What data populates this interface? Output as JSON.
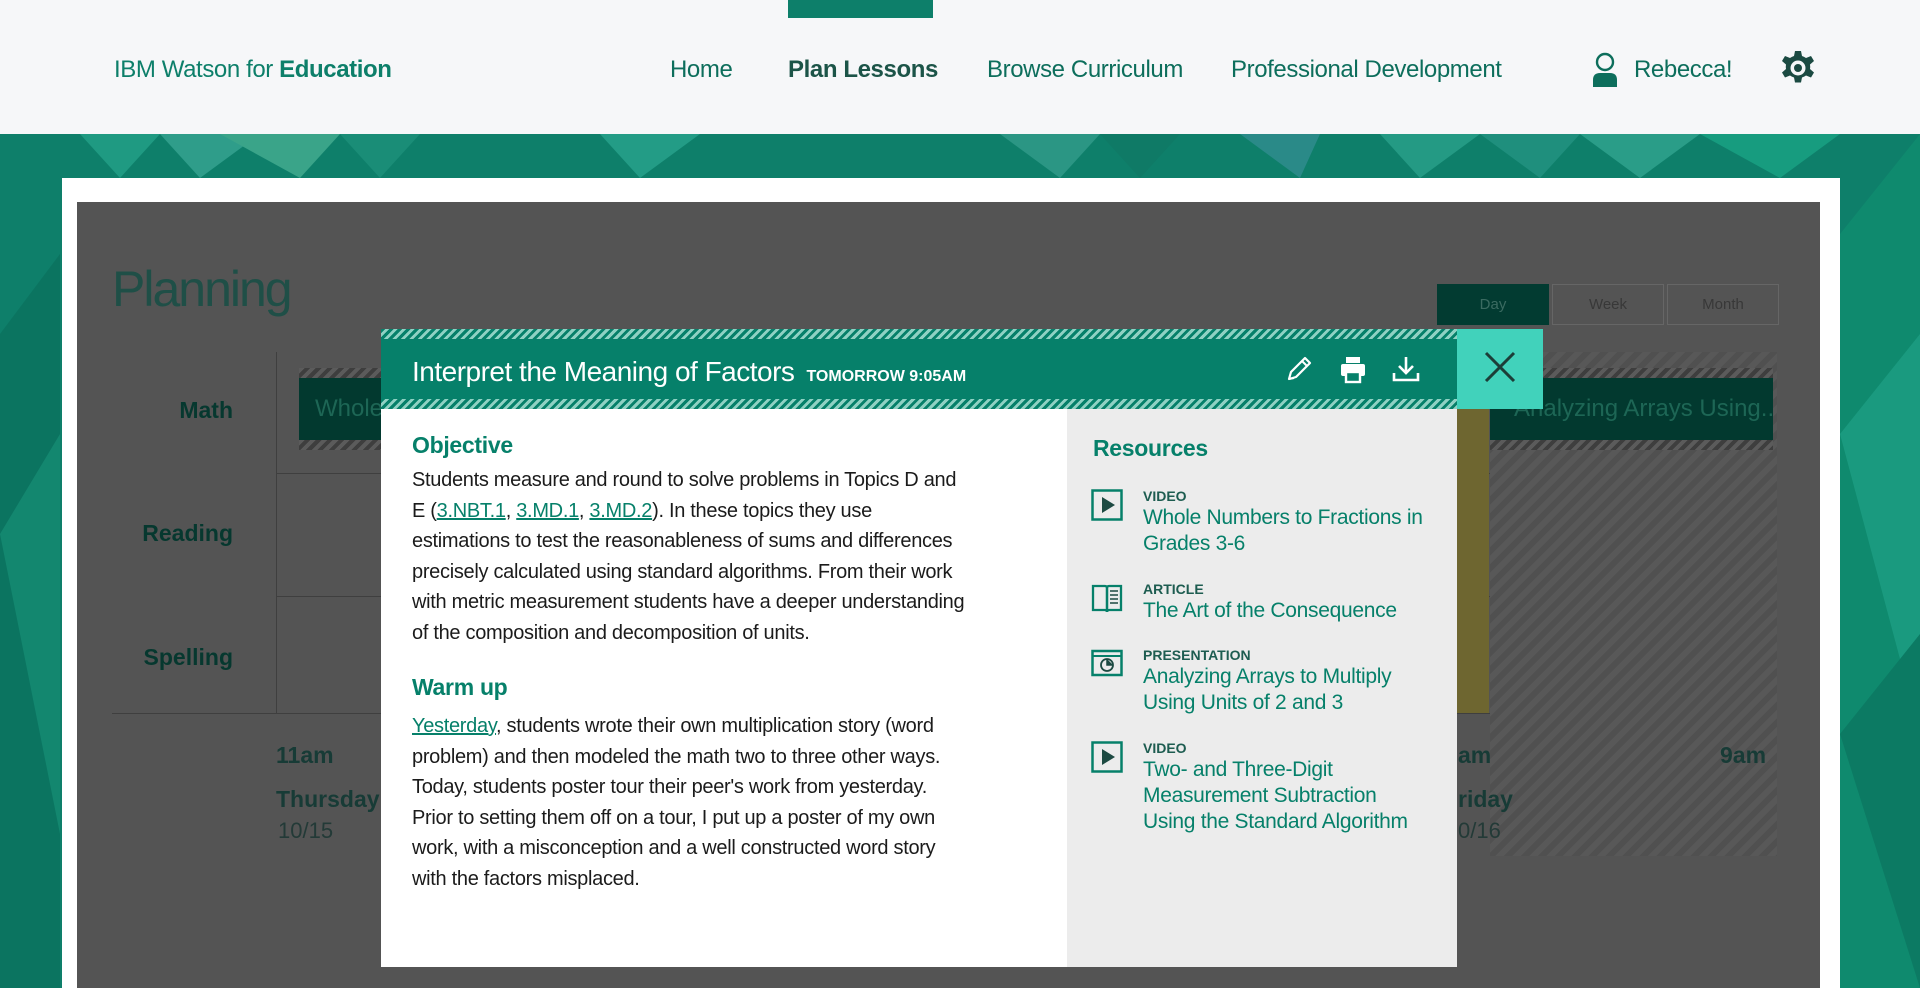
{
  "header": {
    "brand_prefix": "IBM Watson for ",
    "brand_bold": "Education",
    "nav": [
      {
        "label": "Home"
      },
      {
        "label": "Plan Lessons"
      },
      {
        "label": "Browse Curriculum"
      },
      {
        "label": "Professional Development"
      }
    ],
    "user_name": "Rebecca!"
  },
  "planning": {
    "title": "Planning",
    "views": [
      "Day",
      "Week",
      "Month"
    ],
    "active_view": "Day",
    "rows": [
      "Math",
      "Reading",
      "Spelling"
    ],
    "events": {
      "left": "Whole",
      "right": "Analyzing Arrays Using..."
    },
    "columns": [
      {
        "time": "11am",
        "day": "Thursday",
        "date": "10/15"
      },
      {
        "time": "am",
        "day": "riday",
        "date": "0/16"
      },
      {
        "time": "9am"
      }
    ]
  },
  "modal": {
    "title": "Interpret the Meaning of Factors",
    "time": "TOMORROW 9:05AM",
    "objective": {
      "heading": "Objective",
      "before": "Students measure and round to solve problems in Topics D and E (",
      "link1": "3.NBT.1",
      "sep1": ", ",
      "link2": "3.MD.1",
      "sep2": ", ",
      "link3": "3.MD.2",
      "after": ").  In these topics they use estimations to test the reasonableness of sums and differences precisely calculated using standard algorithms. From their work with metric measurement students have a deeper understanding of the composition and decomposition of units."
    },
    "warmup": {
      "heading": "Warm up",
      "link": "Yesterday",
      "text": ", students wrote their own multiplication story (word problem) and then modeled the math two to three other ways. Today, students poster tour their peer's work from yesterday. Prior to setting them off on a tour, I put up a poster of my own work, with a misconception and a well constructed word story with the factors misplaced."
    },
    "resources": {
      "heading": "Resources",
      "items": [
        {
          "type": "VIDEO",
          "icon": "video-play-icon",
          "name": "Whole Numbers to Fractions in Grades 3-6"
        },
        {
          "type": "ARTICLE",
          "icon": "book-icon",
          "name": "The Art of the Consequence"
        },
        {
          "type": "PRESENTATION",
          "icon": "presentation-icon",
          "name": "Analyzing Arrays to Multiply Using Units of 2 and 3"
        },
        {
          "type": "VIDEO",
          "icon": "video-play-icon",
          "name": "Two- and Three-Digit Measurement Subtraction Using the Standard Algorithm"
        }
      ]
    }
  },
  "colors": {
    "primary": "#06806a",
    "accent": "#41d2bb",
    "header_bg": "#f6f7f9",
    "dim_overlay": "#545454"
  }
}
